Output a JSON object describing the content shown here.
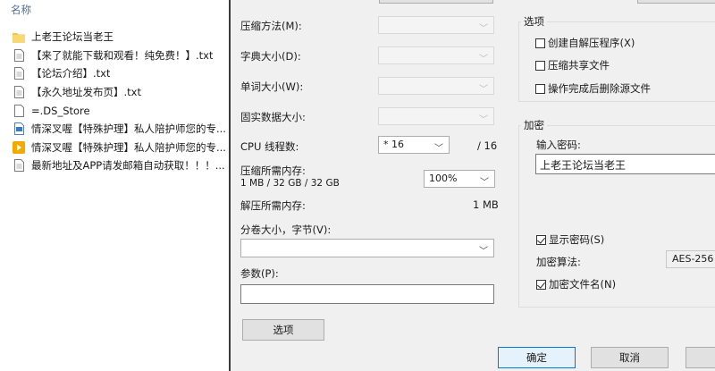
{
  "explorer": {
    "column_header": "名称",
    "files": [
      {
        "name": "上老王论坛当老王",
        "icon": "folder-icon"
      },
      {
        "name": "【来了就能下载和观看！纯免费！】.txt",
        "icon": "text-file-icon"
      },
      {
        "name": "【论坛介绍】.txt",
        "icon": "text-file-icon"
      },
      {
        "name": "【永久地址发布页】.txt",
        "icon": "text-file-icon"
      },
      {
        "name": "=.DS_Store",
        "icon": "blank-file-icon"
      },
      {
        "name": "情深叉喔【特殊护理】私人陪护师您的专...",
        "icon": "image-file-icon"
      },
      {
        "name": "情深叉喔【特殊护理】私人陪护师您的专...",
        "icon": "video-file-icon"
      },
      {
        "name": "最新地址及APP请发邮箱自动获取！！！...",
        "icon": "text-file-icon"
      }
    ]
  },
  "dialog": {
    "compress_method_label": "压缩方法(M):",
    "dict_size_label": "字典大小(D):",
    "word_size_label": "单词大小(W):",
    "solid_block_label": "固实数据大小:",
    "cpu_threads_label": "CPU 线程数:",
    "cpu_threads_value": "* 16",
    "cpu_threads_total": "/ 16",
    "compress_memory_label": "压缩所需内存:",
    "compress_memory_value": "1 MB / 32 GB / 32 GB",
    "memory_percent_value": "100%",
    "decompress_memory_label": "解压所需内存:",
    "decompress_memory_value": "1 MB",
    "split_volume_label": "分卷大小，字节(V):",
    "params_label": "参数(P):",
    "options_button": "选项",
    "ok_button": "确定",
    "cancel_button": "取消",
    "options_group": {
      "title": "选项",
      "create_sfx": "创建自解压程序(X)",
      "compress_shared": "压缩共享文件",
      "delete_after": "操作完成后删除源文件"
    },
    "encryption_group": {
      "title": "加密",
      "enter_password_label": "输入密码:",
      "password_value": "上老王论坛当老王",
      "show_password": "显示密码(S)",
      "encryption_method_label": "加密算法:",
      "encryption_method_value": "AES-256",
      "encrypt_filenames": "加密文件名(N)"
    }
  },
  "colors": {
    "dialog_bg": "#f0f0f0",
    "header_text": "#4d6f9c",
    "primary_border": "#0078d7",
    "folder_yellow": "#f5c542"
  }
}
